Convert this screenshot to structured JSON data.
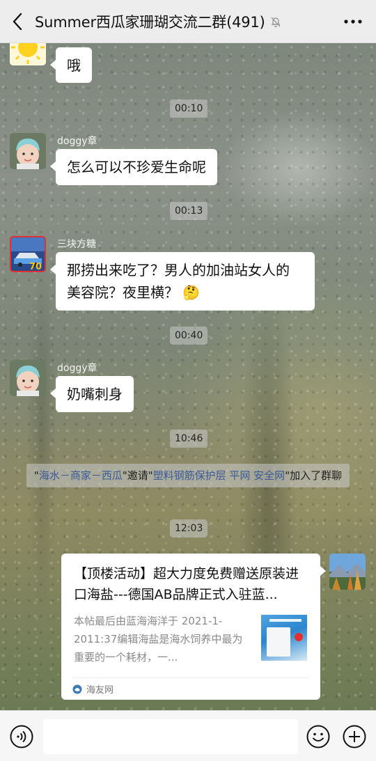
{
  "header": {
    "title": "Summer西瓜家珊瑚交流二群(491)",
    "back_icon": "chevron-left-icon",
    "mute_icon": "bell-off-icon",
    "more_icon": "more-dots-icon"
  },
  "messages": [
    {
      "type": "text",
      "side": "left",
      "sender": "",
      "avatar": "sun-avatar",
      "text": "哦"
    },
    {
      "type": "time",
      "text": "00:10"
    },
    {
      "type": "text",
      "side": "left",
      "sender": "doggy章",
      "avatar": "baby-avatar",
      "text": "怎么可以不珍爱生命呢"
    },
    {
      "type": "time",
      "text": "00:13"
    },
    {
      "type": "text",
      "side": "left",
      "sender": "三块方糖",
      "avatar": "car-avatar",
      "text_line1": "那捞出来吃了？男人的加油站女人的",
      "text_line2": "美容院？夜里横？",
      "emoji": "🤔"
    },
    {
      "type": "time",
      "text": "00:40"
    },
    {
      "type": "text",
      "side": "left",
      "sender": "doggy章",
      "avatar": "baby-avatar",
      "text": "奶嘴刺身"
    },
    {
      "type": "time",
      "text": "10:46"
    },
    {
      "type": "system",
      "quote1": "\"",
      "inviter": "海水－商家－西瓜",
      "mid": "\"邀请\"",
      "invitee": "塑料钢筋保护层 平网 安全网",
      "tail": "\"加入了群聊"
    },
    {
      "type": "time",
      "text": "12:03"
    },
    {
      "type": "link-card",
      "side": "right",
      "avatar": "landscape-avatar",
      "title": "【顶楼活动】超大力度免费赠送原装进口海盐---德国AB品牌正式入驻蓝...",
      "description": "本帖最后由蓝海海洋于 2021-1-2011:37编辑海盐是海水饲养中最为重要的一个耗材，一...",
      "source": "海友网",
      "source_icon": "site-logo-icon"
    }
  ],
  "input_bar": {
    "voice_icon": "voice-icon",
    "emoji_icon": "emoji-icon",
    "plus_icon": "plus-circle-icon",
    "input_value": ""
  },
  "colors": {
    "header_bg": "#ededed",
    "bubble_bg": "#ffffff",
    "system_link": "#3b5a9a",
    "bottom_bg": "#f6f6f6"
  }
}
